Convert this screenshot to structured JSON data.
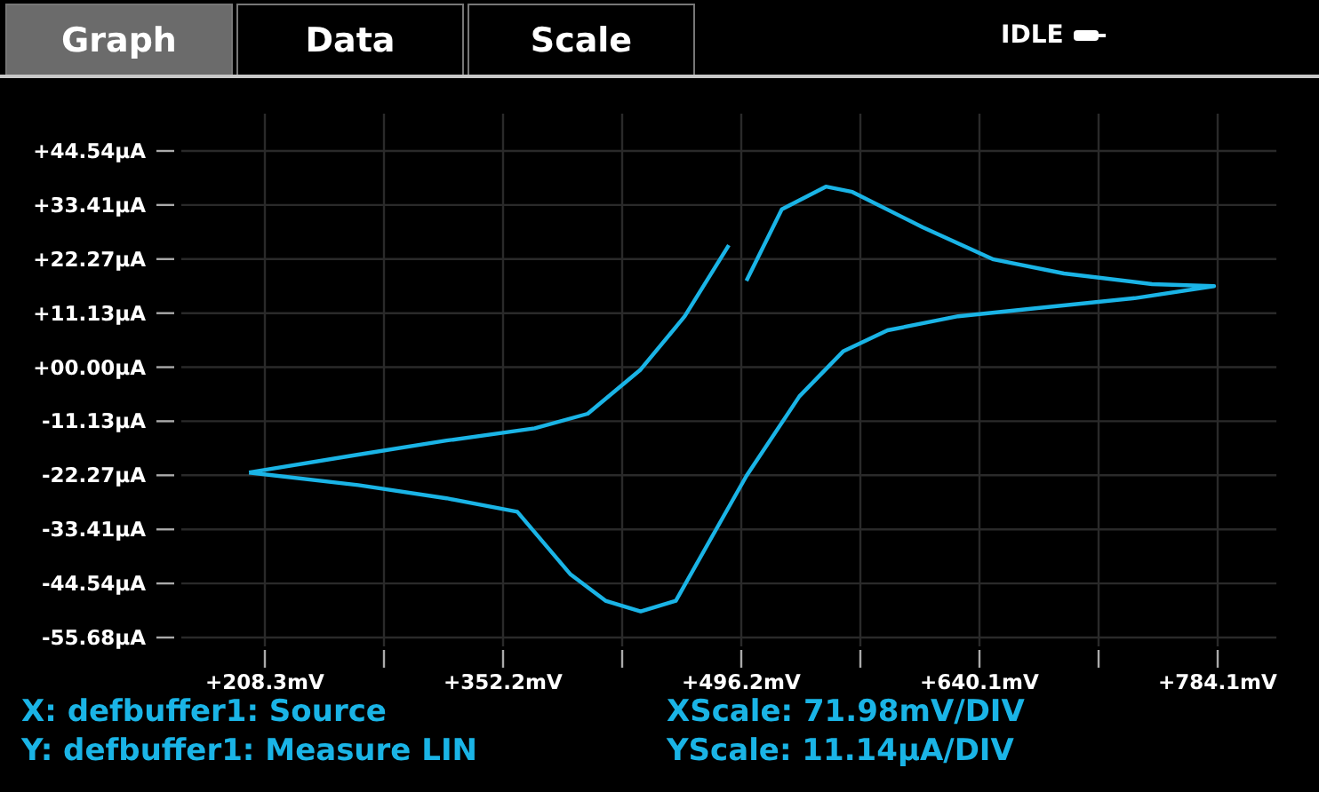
{
  "tabs": [
    {
      "label": "Graph",
      "selected": true
    },
    {
      "label": "Data",
      "selected": false
    },
    {
      "label": "Scale",
      "selected": false
    }
  ],
  "status": {
    "text": "IDLE"
  },
  "graph": {
    "chart_data": {
      "type": "line",
      "x": [
        198.7,
        264.8,
        318.1,
        371.4,
        403.4,
        435.4,
        462.0,
        488.7,
        null,
        499.3,
        520.7,
        547.3,
        563.3,
        605.9,
        648.6,
        691.2,
        744.5,
        781.9,
        733.9,
        669.9,
        627.3,
        584.6,
        558.0,
        531.3,
        499.3,
        478.0,
        456.7,
        435.4,
        414.1,
        392.7,
        360.8,
        318.1,
        264.8,
        198.7
      ],
      "xlim": [
        157.8,
        819.6
      ],
      "ylim": [
        -57.5,
        52.2
      ],
      "grid": true,
      "series": [
        {
          "color": "#1ab4e6",
          "values": [
            -21.7,
            -18.0,
            -15.1,
            -12.6,
            -9.6,
            -0.5,
            10.5,
            25.1,
            null,
            17.8,
            32.5,
            37.2,
            36.1,
            28.8,
            22.2,
            19.3,
            17.1,
            16.7,
            14.2,
            12.0,
            10.5,
            7.6,
            3.3,
            -6.0,
            -22.4,
            -35.2,
            -48.1,
            -50.3,
            -48.1,
            -42.6,
            -29.8,
            -27.0,
            -24.3,
            -21.7
          ]
        }
      ],
      "xticks": [
        {
          "value": 208.3,
          "label": "+208.3mV"
        },
        {
          "value": 352.2,
          "label": "+352.2mV"
        },
        {
          "value": 496.2,
          "label": "+496.2mV"
        },
        {
          "value": 640.1,
          "label": "+640.1mV"
        },
        {
          "value": 784.1,
          "label": "+784.1mV"
        }
      ],
      "yticks": [
        {
          "value": 44.54,
          "label": "+44.54µA"
        },
        {
          "value": 33.41,
          "label": "+33.41µA"
        },
        {
          "value": 22.27,
          "label": "+22.27µA"
        },
        {
          "value": 11.13,
          "label": "+11.13µA"
        },
        {
          "value": 0,
          "label": "+00.00µA"
        },
        {
          "value": -11.13,
          "label": "-11.13µA"
        },
        {
          "value": -22.27,
          "label": "-22.27µA"
        },
        {
          "value": -33.41,
          "label": "-33.41µA"
        },
        {
          "value": -44.54,
          "label": "-44.54µA"
        },
        {
          "value": -55.68,
          "label": "-55.68µA"
        }
      ]
    }
  },
  "legend": {
    "x_source": "X: defbuffer1: Source",
    "x_scale": "XScale: 71.98mV/DIV",
    "y_source": "Y: defbuffer1: Measure LIN",
    "y_scale": "YScale: 11.14µA/DIV"
  }
}
